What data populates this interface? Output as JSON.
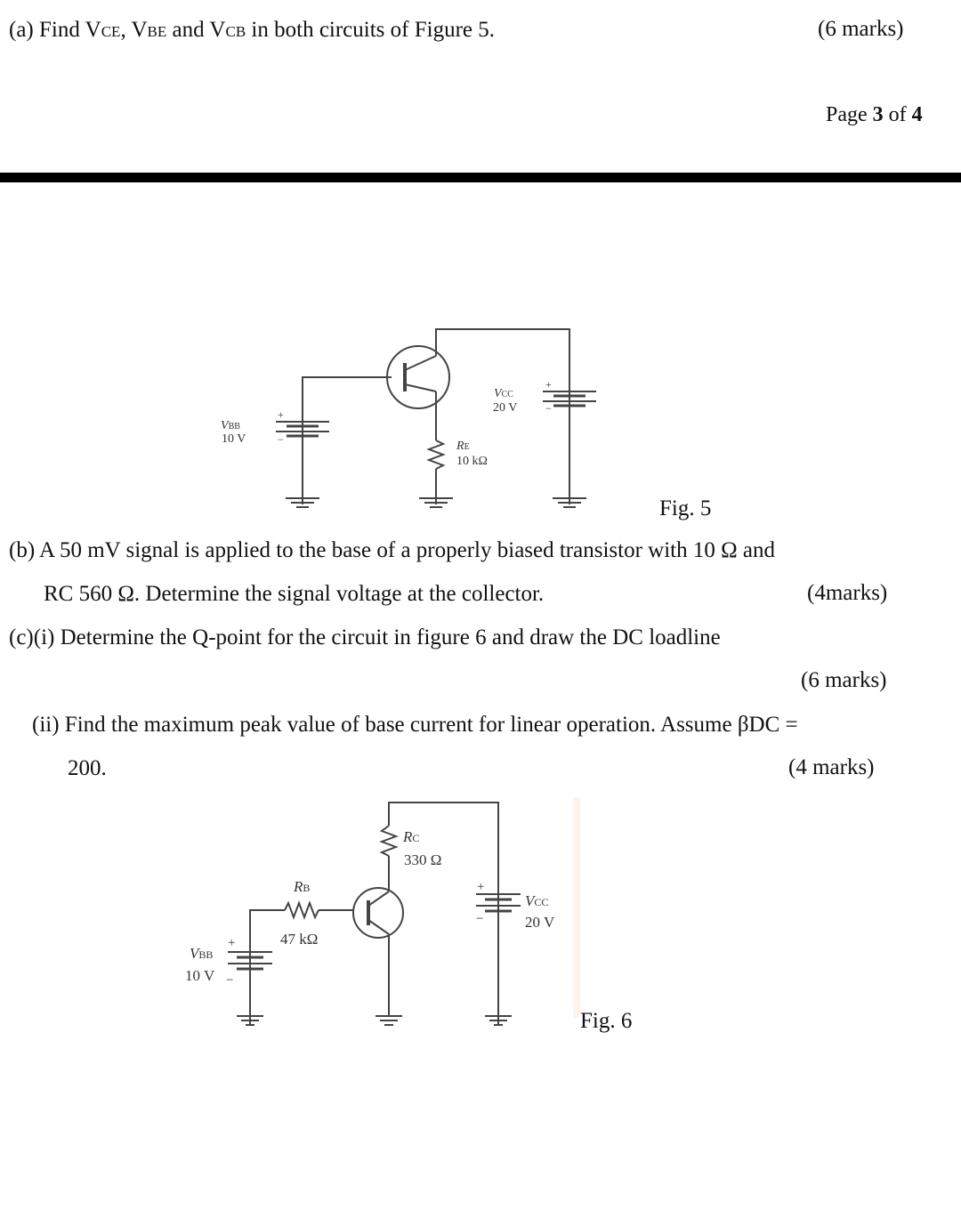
{
  "question_a": {
    "prefix": "(a) Find V",
    "vce_sub": "CE",
    "comma": ", V",
    "vbe_sub": "BE",
    "and_text": " and V",
    "vcb_sub": "CB",
    "suffix": " in both circuits of Figure 5.",
    "marks": "(6 marks)"
  },
  "page_indicator": {
    "prefix": "Page ",
    "current": "3",
    "middle": " of ",
    "total": "4"
  },
  "figure5": {
    "caption": "Fig. 5",
    "vbb_label": "V",
    "vbb_sub": "BB",
    "vbb_value": "10 V",
    "vcc_label": "V",
    "vcc_sub": "CC",
    "vcc_value": "20 V",
    "re_label": "R",
    "re_sub": "E",
    "re_value": "10 kΩ",
    "plus": "+",
    "minus": "−"
  },
  "question_b": {
    "line1": "(b) A 50 mV signal is applied to the base of a properly biased transistor with 10 Ω and",
    "line2": "RC 560 Ω. Determine the signal voltage at the collector.",
    "marks": "(4marks)"
  },
  "question_c": {
    "part_i": "(c)(i) Determine the Q-point for the circuit in figure 6 and draw the DC loadline",
    "part_i_marks": "(6 marks)",
    "part_ii_line1": "(ii) Find the maximum peak value of base current for linear operation. Assume βDC =",
    "part_ii_line2": "200.",
    "part_ii_marks": "(4 marks)"
  },
  "figure6": {
    "caption": "Fig. 6",
    "rc_label": "R",
    "rc_sub": "C",
    "rc_value": "330 Ω",
    "rb_label": "R",
    "rb_sub": "B",
    "rb_value": "47 kΩ",
    "vbb_label": "V",
    "vbb_sub": "BB",
    "vbb_value": "10 V",
    "vcc_label": "V",
    "vcc_sub": "CC",
    "vcc_value": "20 V",
    "plus": "+",
    "minus": "−"
  }
}
